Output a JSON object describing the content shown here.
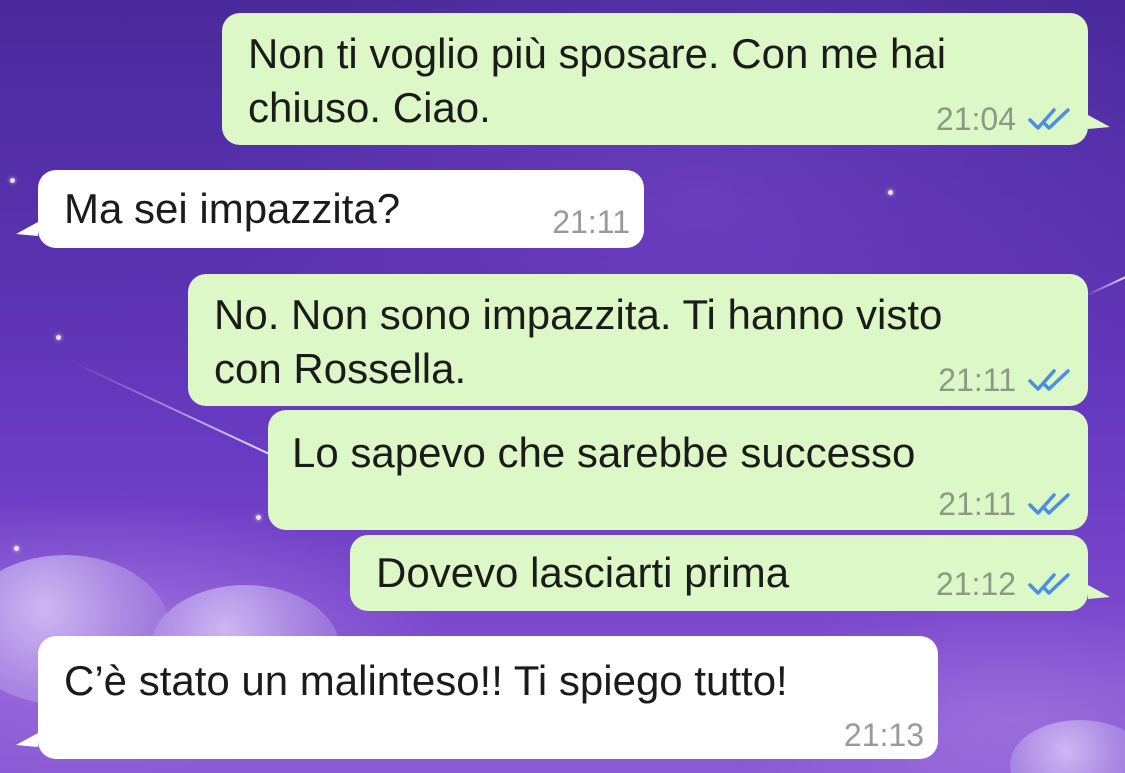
{
  "colors": {
    "outgoing_bubble": "#dcf8c6",
    "incoming_bubble": "#ffffff",
    "read_receipt": "#4a90e2"
  },
  "messages": [
    {
      "direction": "outgoing",
      "text": "Non ti voglio più sposare. Con me hai\nchiuso. Ciao.",
      "time": "21:04",
      "status": "read-double-check-icon"
    },
    {
      "direction": "incoming",
      "text": "Ma sei impazzita?",
      "time": "21:11"
    },
    {
      "direction": "outgoing",
      "text": "No. Non sono impazzita. Ti hanno visto\ncon Rossella.",
      "time": "21:11",
      "status": "read-double-check-icon"
    },
    {
      "direction": "outgoing",
      "text": "Lo sapevo che sarebbe successo",
      "time": "21:11",
      "status": "read-double-check-icon"
    },
    {
      "direction": "outgoing",
      "text": "Dovevo lasciarti prima",
      "time": "21:12",
      "status": "read-double-check-icon"
    },
    {
      "direction": "incoming",
      "text": "C’è stato un malinteso!! Ti spiego tutto!",
      "time": "21:13"
    }
  ]
}
